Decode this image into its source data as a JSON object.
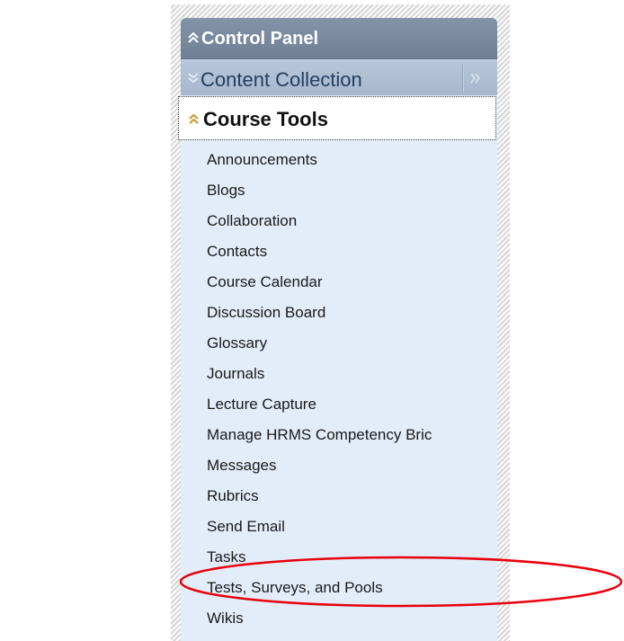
{
  "control_panel": {
    "title": "Control Panel",
    "icon": "collapse-chevron-icon"
  },
  "content_collection": {
    "title": "Content Collection",
    "icon": "expand-chevron-icon",
    "expand_icon": "double-right-chevron-icon"
  },
  "course_tools": {
    "title": "Course Tools",
    "icon": "collapse-chevron-icon",
    "items": [
      {
        "label": "Announcements"
      },
      {
        "label": "Blogs"
      },
      {
        "label": "Collaboration"
      },
      {
        "label": "Contacts"
      },
      {
        "label": "Course Calendar"
      },
      {
        "label": "Discussion Board"
      },
      {
        "label": "Glossary"
      },
      {
        "label": "Journals"
      },
      {
        "label": "Lecture Capture"
      },
      {
        "label": "Manage HRMS Competency Bric"
      },
      {
        "label": "Messages"
      },
      {
        "label": "Rubrics"
      },
      {
        "label": "Send Email"
      },
      {
        "label": "Tasks"
      },
      {
        "label": "Tests, Surveys, and Pools"
      },
      {
        "label": "Wikis"
      }
    ]
  },
  "annotation": {
    "shape": "ellipse",
    "color": "#e8000b",
    "highlighted_item": "Tests, Surveys, and Pools"
  },
  "colors": {
    "header_bg": "#7a8aa0",
    "subheader_bg": "#aebfd3",
    "panel_bg": "#e3edf9",
    "chevron_gold": "#c9a13b"
  }
}
